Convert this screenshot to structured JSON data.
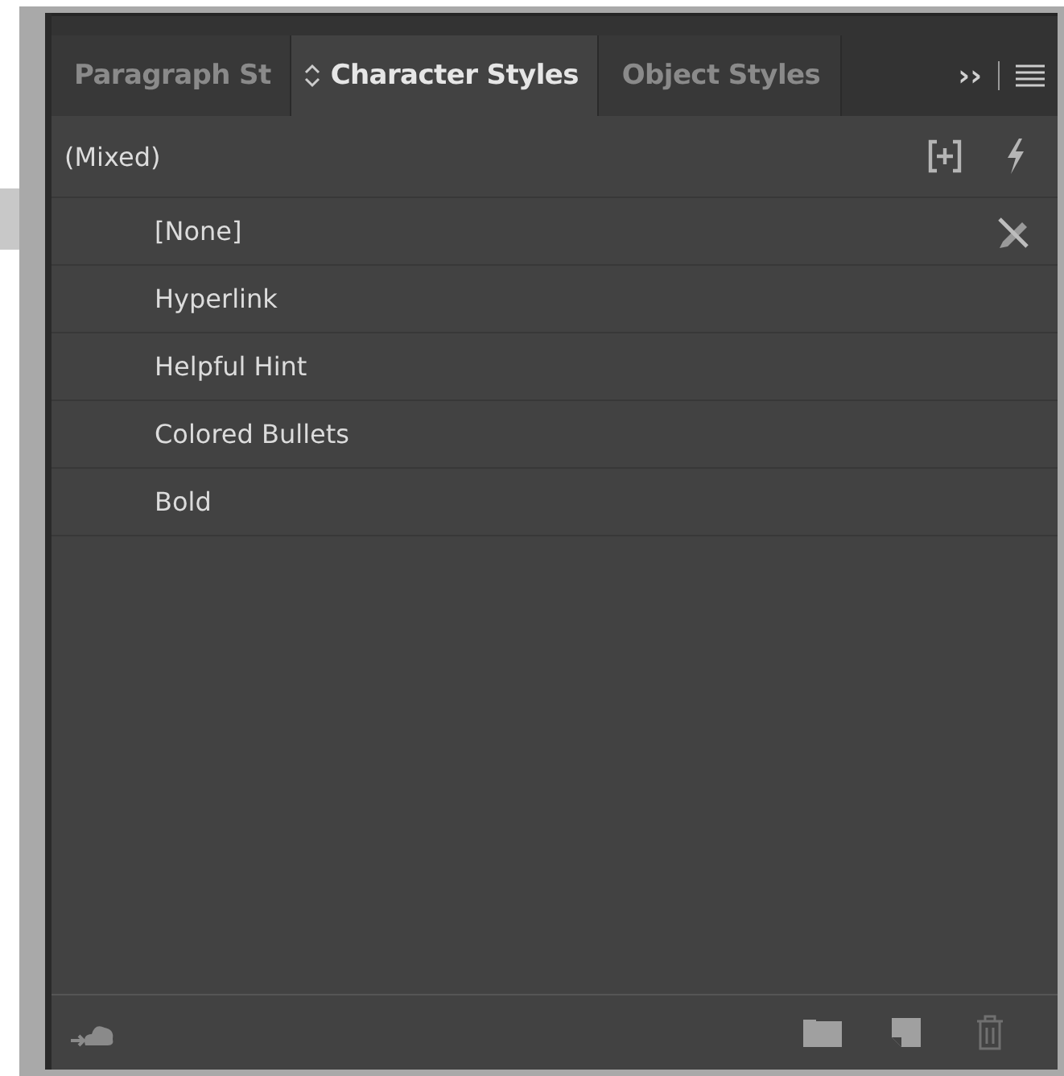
{
  "tabs": [
    {
      "label": "Paragraph St",
      "selected": false,
      "kind": "plain"
    },
    {
      "label": "Character Styles",
      "selected": true,
      "kind": "sortable"
    },
    {
      "label": "Object Styles",
      "selected": false,
      "kind": "plain"
    }
  ],
  "overflow": "››",
  "current_style": "(Mixed)",
  "styles": [
    {
      "name": "[None]",
      "kind": "none"
    },
    {
      "name": "Hyperlink",
      "kind": "style"
    },
    {
      "name": "Helpful Hint",
      "kind": "style"
    },
    {
      "name": "Colored Bullets",
      "kind": "style"
    },
    {
      "name": "Bold",
      "kind": "style"
    }
  ]
}
